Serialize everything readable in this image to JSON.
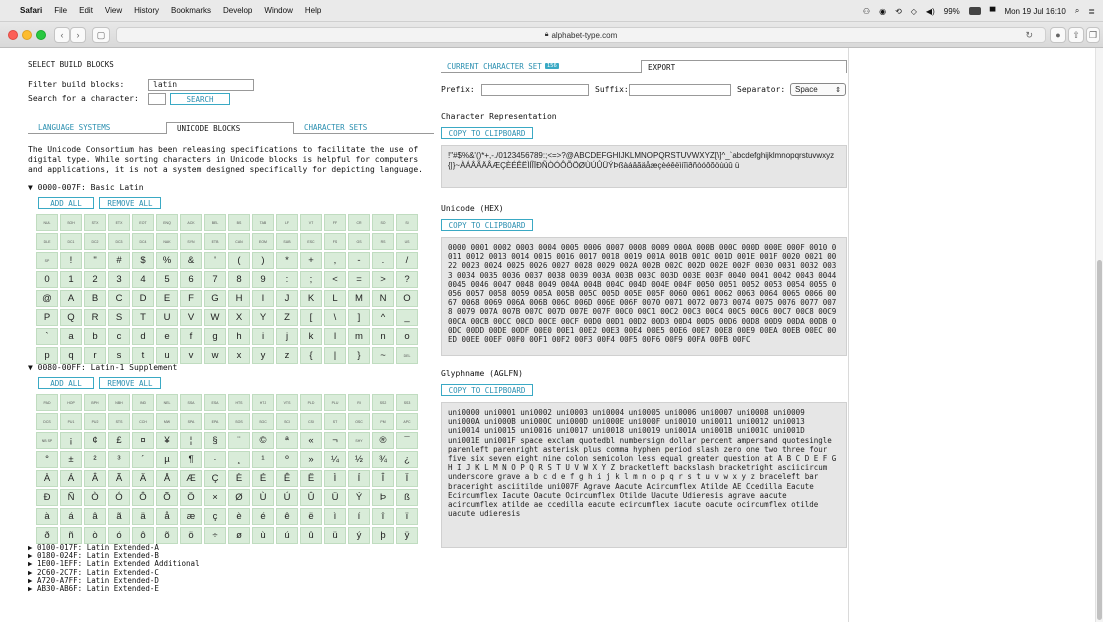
{
  "menubar": {
    "app": "Safari",
    "items": [
      "File",
      "Edit",
      "View",
      "History",
      "Bookmarks",
      "Develop",
      "Window",
      "Help"
    ],
    "battery": "99%",
    "clock": "Mon 19 Jul  16:10"
  },
  "browser": {
    "url": "alphabet-type.com"
  },
  "left": {
    "title": "SELECT BUILD BLOCKS",
    "filter_label": "Filter build blocks:",
    "filter_value": "latin",
    "search_label": "Search for a character:",
    "search_value": "",
    "search_button": "SEARCH",
    "tabs": [
      "LANGUAGE SYSTEMS",
      "UNICODE BLOCKS",
      "CHARACTER SETS"
    ],
    "intro": "The Unicode Consortium has been releasing specifications to facilitate the use of digital type. While sorting characters in Unicode blocks is helpful for computers and applications, it is not a system designed specifically for depicting language.",
    "block1": {
      "title": "▼ 0000-007F: Basic Latin",
      "add": "ADD ALL",
      "remove": "REMOVE ALL",
      "cells": [
        "NUL",
        "SOH",
        "STX",
        "ETX",
        "EOT",
        "ENQ",
        "ACK",
        "BEL",
        "BS",
        "TAB",
        "LF",
        "VT",
        "FF",
        "CR",
        "SO",
        "SI",
        "DLE",
        "DC1",
        "DC2",
        "DC3",
        "DC4",
        "NAK",
        "SYN",
        "ETB",
        "CAN",
        "EOM",
        "SUB",
        "ESC",
        "FS",
        "GS",
        "RS",
        "US",
        "SP",
        "!",
        "\"",
        "#",
        "$",
        "%",
        "&",
        "'",
        "(",
        ")",
        "*",
        "+",
        ",",
        "-",
        ".",
        "/",
        "0",
        "1",
        "2",
        "3",
        "4",
        "5",
        "6",
        "7",
        "8",
        "9",
        ":",
        ";",
        "<",
        "=",
        ">",
        "?",
        "@",
        "A",
        "B",
        "C",
        "D",
        "E",
        "F",
        "G",
        "H",
        "I",
        "J",
        "K",
        "L",
        "M",
        "N",
        "O",
        "P",
        "Q",
        "R",
        "S",
        "T",
        "U",
        "V",
        "W",
        "X",
        "Y",
        "Z",
        "[",
        "\\",
        "]",
        "^",
        "_",
        "`",
        "a",
        "b",
        "c",
        "d",
        "e",
        "f",
        "g",
        "h",
        "i",
        "j",
        "k",
        "l",
        "m",
        "n",
        "o",
        "p",
        "q",
        "r",
        "s",
        "t",
        "u",
        "v",
        "w",
        "x",
        "y",
        "z",
        "{",
        "|",
        "}",
        "~",
        "DEL"
      ]
    },
    "block2": {
      "title": "▼ 0080-00FF: Latin-1 Supplement",
      "add": "ADD ALL",
      "remove": "REMOVE ALL",
      "cells": [
        "PAD",
        "HOP",
        "BPH",
        "NBH",
        "IND",
        "NEL",
        "SSA",
        "ESA",
        "HTS",
        "HTJ",
        "VTS",
        "PLD",
        "PLU",
        "RI",
        "SS2",
        "SS3",
        "DCS",
        "PU1",
        "PU2",
        "STS",
        "CCH",
        "MW",
        "SPA",
        "EPA",
        "SOS",
        "SGC",
        "SCI",
        "CSI",
        "ST",
        "OSC",
        "PM",
        "APC",
        "NB SP",
        "¡",
        "¢",
        "£",
        "¤",
        "¥",
        "¦",
        "§",
        "¨",
        "©",
        "ª",
        "«",
        "¬",
        "SHY",
        "®",
        "¯",
        "°",
        "±",
        "²",
        "³",
        "´",
        "µ",
        "¶",
        "·",
        "¸",
        "¹",
        "º",
        "»",
        "¼",
        "½",
        "¾",
        "¿",
        "À",
        "Á",
        "Â",
        "Ã",
        "Ä",
        "Å",
        "Æ",
        "Ç",
        "È",
        "É",
        "Ê",
        "Ë",
        "Ì",
        "Í",
        "Î",
        "Ï",
        "Ð",
        "Ñ",
        "Ò",
        "Ó",
        "Ô",
        "Õ",
        "Ö",
        "×",
        "Ø",
        "Ù",
        "Ú",
        "Û",
        "Ü",
        "Ý",
        "Þ",
        "ß",
        "à",
        "á",
        "â",
        "ã",
        "ä",
        "å",
        "æ",
        "ç",
        "è",
        "é",
        "ê",
        "ë",
        "ì",
        "í",
        "î",
        "ï",
        "ð",
        "ñ",
        "ò",
        "ó",
        "ô",
        "õ",
        "ö",
        "÷",
        "ø",
        "ù",
        "ú",
        "û",
        "ü",
        "ý",
        "þ",
        "ÿ"
      ]
    },
    "collapsed_blocks": [
      "▶ 0100-017F: Latin Extended-A",
      "▶ 0180-024F: Latin Extended-B",
      "▶ 1E00-1EFF: Latin Extended Additional",
      "▶ 2C60-2C7F: Latin Extended-C",
      "▶ A720-A7FF: Latin Extended-D",
      "▶ AB30-AB6F: Latin Extended-E"
    ]
  },
  "right": {
    "tab_current": "CURRENT CHARACTER SET",
    "tab_count": "156",
    "tab_export": "EXPORT",
    "prefix_label": "Prefix:",
    "suffix_label": "Suffix:",
    "separator_label": "Separator:",
    "separator_value": "Space",
    "char_rep_title": "Character Representation",
    "copy_label": "COPY TO CLIPBOARD",
    "char_rep": "!\"#$%&'()*+,-./0123456789:;<=>?@ABCDEFGHIJKLMNOPQRSTUVWXYZ[\\]^_`abcdefghijklmnopqrstuvwxyz{|}~ÀÁÂÃÄÅÆÇÈÉÊËÌÍÎÏÐÑÒÓÔÕÖØÙÚÛÜÝÞßàáâãäåæçèéêëìíîïðñòóôõöùúû ü",
    "hex_title": "Unicode (HEX)",
    "hex": "0000 0001 0002 0003 0004 0005 0006 0007 0008 0009 000A 000B 000C 000D 000E 000F 0010 0011 0012 0013 0014 0015 0016 0017 0018 0019 001A 001B 001C 001D 001E 001F 0020 0021 0022 0023 0024 0025 0026 0027 0028 0029 002A 002B 002C 002D 002E 002F 0030 0031 0032 0033 0034 0035 0036 0037 0038 0039 003A 003B 003C 003D 003E 003F 0040 0041 0042 0043 0044 0045 0046 0047 0048 0049 004A 004B 004C 004D 004E 004F 0050 0051 0052 0053 0054 0055 0056 0057 0058 0059 005A 005B 005C 005D 005E 005F 0060 0061 0062 0063 0064 0065 0066 0067 0068 0069 006A 006B 006C 006D 006E 006F 0070 0071 0072 0073 0074 0075 0076 0077 0078 0079 007A 007B 007C 007D 007E 007F 00C0 00C1 00C2 00C3 00C4 00C5 00C6 00C7 00C8 00C9 00CA 00CB 00CC 00CD 00CE 00CF 00D0 00D1 00D2 00D3 00D4 00D5 00D6 00D8 00D9 00DA 00DB 00DC 00DD 00DE 00DF 00E0 00E1 00E2 00E3 00E4 00E5 00E6 00E7 00E8 00E9 00EA 00EB 00EC 00ED 00EE 00EF 00F0 00F1 00F2 00F3 00F4 00F5 00F6 00F9 00FA 00FB 00FC",
    "glyph_title": "Glyphname (AGLFN)",
    "glyph": "uni0000 uni0001 uni0002 uni0003 uni0004 uni0005 uni0006 uni0007 uni0008 uni0009 uni000A uni000B uni000C uni000D uni000E uni000F uni0010 uni0011 uni0012 uni0013 uni0014 uni0015 uni0016 uni0017 uni0018 uni0019 uni001A uni001B uni001C uni001D uni001E uni001F space exclam quotedbl numbersign dollar percent ampersand quotesingle parenleft parenright asterisk plus comma hyphen period slash zero one two three four five six seven eight nine colon semicolon less equal greater question at A B C D E F G H I J K L M N O P Q R S T U V W X Y Z bracketleft backslash bracketright asciicircum underscore grave a b c d e f g h i j k l m n o p q r s t u v w x y z braceleft bar braceright asciitilde uni007F Agrave Aacute Acircumflex Atilde AE Ccedilla Eacute Ecircumflex Iacute Oacute Ocircumflex Otilde Uacute Udieresis agrave aacute acircumflex atilde ae ccedilla eacute ecircumflex iacute oacute ocircumflex otilde uacute udieresis"
  }
}
